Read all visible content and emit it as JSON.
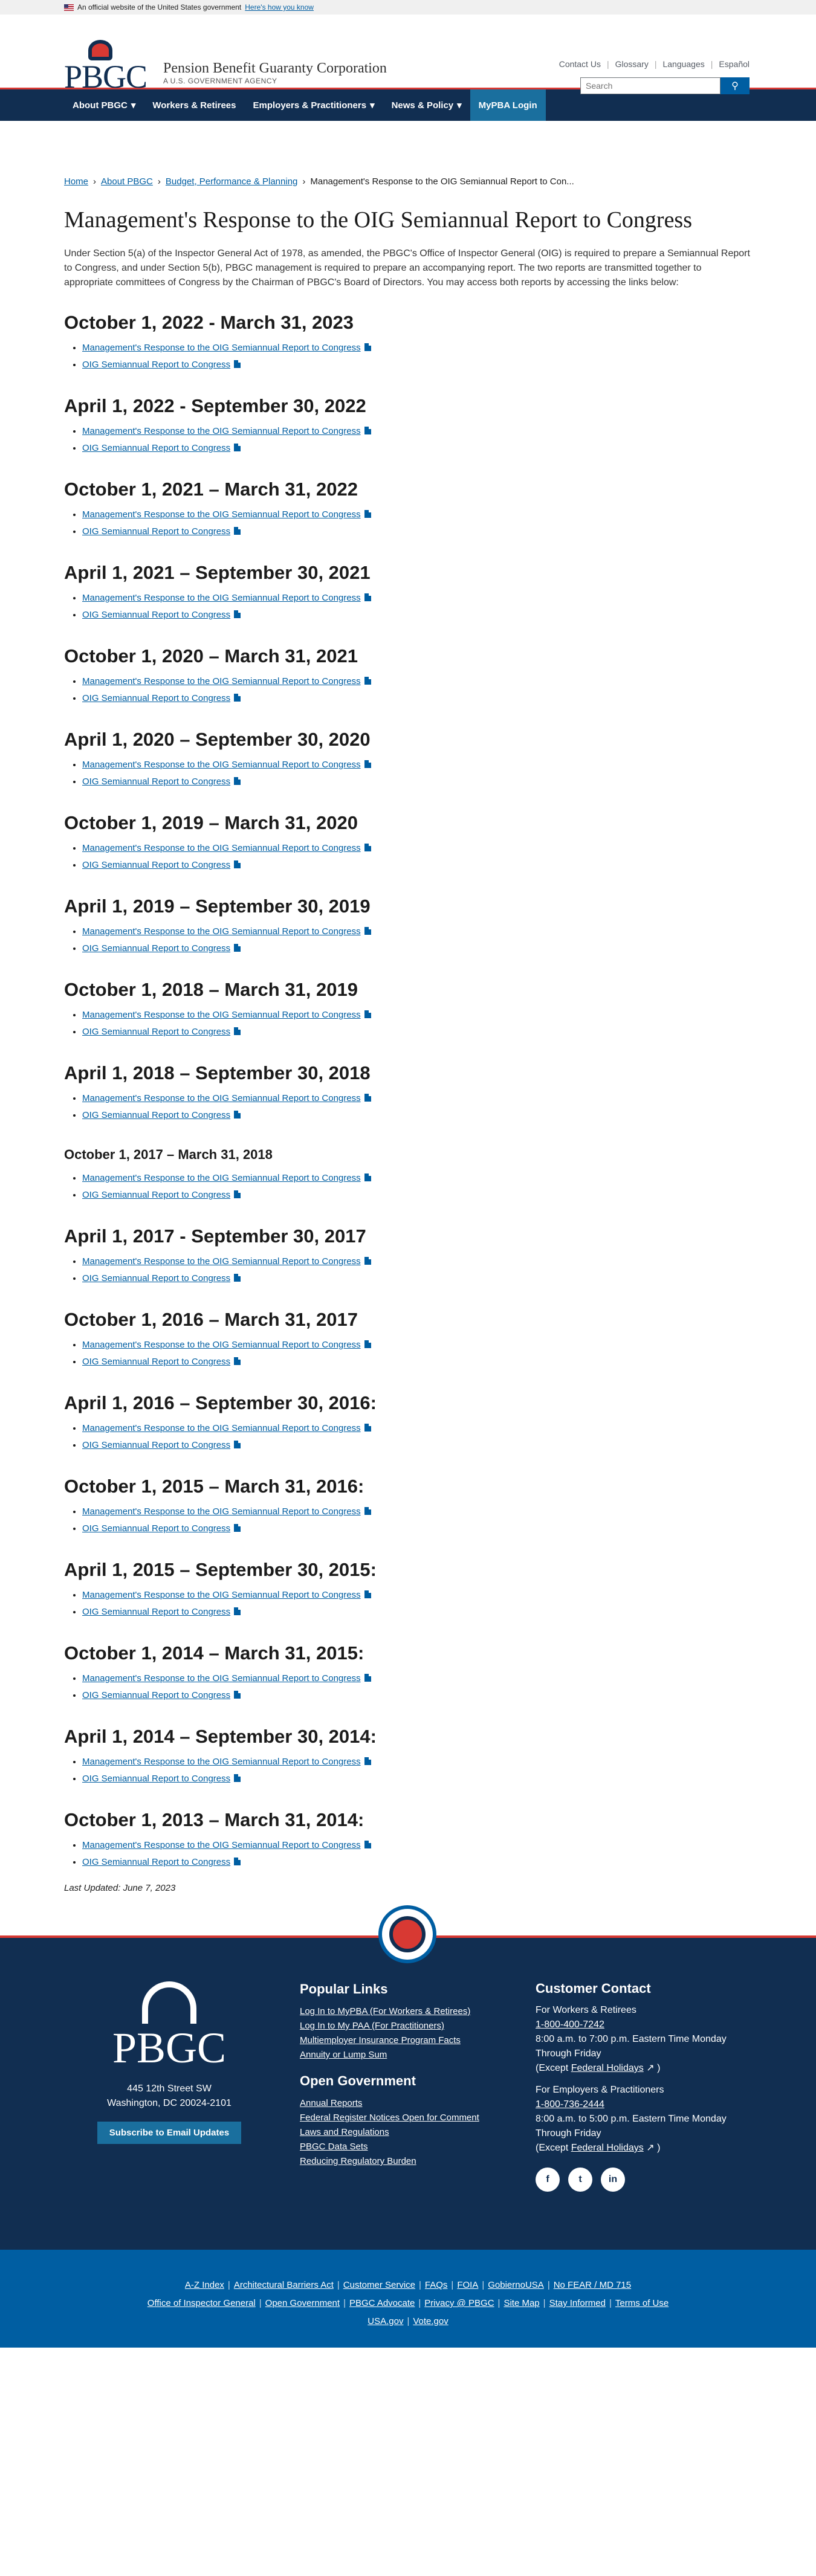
{
  "gov_banner": {
    "text": "An official website of the United States government",
    "link": "Here's how you know"
  },
  "header": {
    "logo": "PBGC",
    "org_name": "Pension Benefit Guaranty Corporation",
    "org_sub": "A U.S. GOVERNMENT AGENCY",
    "utility": [
      "Contact Us",
      "Glossary",
      "Languages",
      "Español"
    ],
    "search_placeholder": "Search"
  },
  "nav": [
    "About PBGC",
    "Workers & Retirees",
    "Employers & Practitioners",
    "News & Policy",
    "MyPBA Login"
  ],
  "breadcrumb": [
    "Home",
    "About PBGC",
    "Budget, Performance & Planning",
    "Management's Response to the OIG Semiannual Report to Con..."
  ],
  "title": "Management's Response to the OIG Semiannual Report to Congress",
  "intro": "Under Section 5(a) of the Inspector General Act of 1978, as amended, the PBGC's Office of Inspector General (OIG) is required to prepare a Semiannual Report to Congress, and under Section 5(b), PBGC management is required to prepare an accompanying report. The two reports are transmitted together to appropriate committees of Congress by the Chairman of PBGC's Board of Directors. You may access both reports by accessing the links below:",
  "link_labels": {
    "mgmt": "Management's Response to the OIG Semiannual Report to Congress",
    "oig": "OIG Semiannual Report to Congress"
  },
  "periods": [
    "October 1, 2022 - March 31, 2023",
    "April 1, 2022 - September 30, 2022",
    "October 1, 2021 – March 31, 2022",
    "April 1, 2021 – September 30, 2021",
    "October 1, 2020 – March 31, 2021",
    "April 1, 2020 – September 30, 2020",
    "October 1, 2019 – March 31, 2020",
    "April 1, 2019 – September 30, 2019",
    "October 1, 2018 – March 31, 2019",
    "April 1, 2018 – September 30, 2018",
    "October 1, 2017 – March 31, 2018",
    "April 1, 2017 - September 30, 2017",
    "October 1, 2016 – March 31, 2017",
    "April 1, 2016 – September 30, 2016:",
    "October 1, 2015 – March 31, 2016:",
    "April 1, 2015 – September 30, 2015:",
    "October 1, 2014 – March 31, 2015:",
    "April 1, 2014 – September 30, 2014:",
    "October 1, 2013 – March 31, 2014:"
  ],
  "last_updated": "Last Updated: June 7, 2023",
  "footer": {
    "logo": "PBGC",
    "address1": "445 12th Street SW",
    "address2": "Washington, DC 20024-2101",
    "subscribe": "Subscribe to Email Updates",
    "popular_title": "Popular Links",
    "popular": [
      "Log In to MyPBA (For Workers & Retirees)",
      "Log In to My PAA (For Practitioners)",
      "Multiemployer Insurance Program Facts",
      "Annuity or Lump Sum"
    ],
    "open_title": "Open Government",
    "open": [
      "Annual Reports",
      "Federal Register Notices Open for Comment",
      "Laws and Regulations",
      "PBGC Data Sets",
      "Reducing Regulatory Burden"
    ],
    "contact_title": "Customer Contact",
    "workers_label": "For Workers & Retirees",
    "workers_phone": "1-800-400-7242",
    "workers_hours": "8:00 a.m. to 7:00 p.m. Eastern Time Monday Through Friday",
    "except": "(Except",
    "holidays": "Federal Holidays",
    "close": ")",
    "employers_label": "For Employers & Practitioners",
    "employers_phone": "1-800-736-2444",
    "employers_hours": "8:00 a.m. to 5:00 p.m. Eastern Time Monday Through Friday",
    "social": [
      "f",
      "t",
      "in"
    ],
    "bottom_row1": [
      "A-Z Index",
      "Architectural Barriers Act",
      "Customer Service",
      "FAQs",
      "FOIA",
      "GobiernoUSA",
      "No FEAR / MD 715"
    ],
    "bottom_row2": [
      "Office of Inspector General",
      "Open Government",
      "PBGC Advocate",
      "Privacy @ PBGC",
      "Site Map",
      "Stay Informed",
      "Terms of Use"
    ],
    "bottom_row3": [
      "USA.gov",
      "Vote.gov"
    ]
  }
}
